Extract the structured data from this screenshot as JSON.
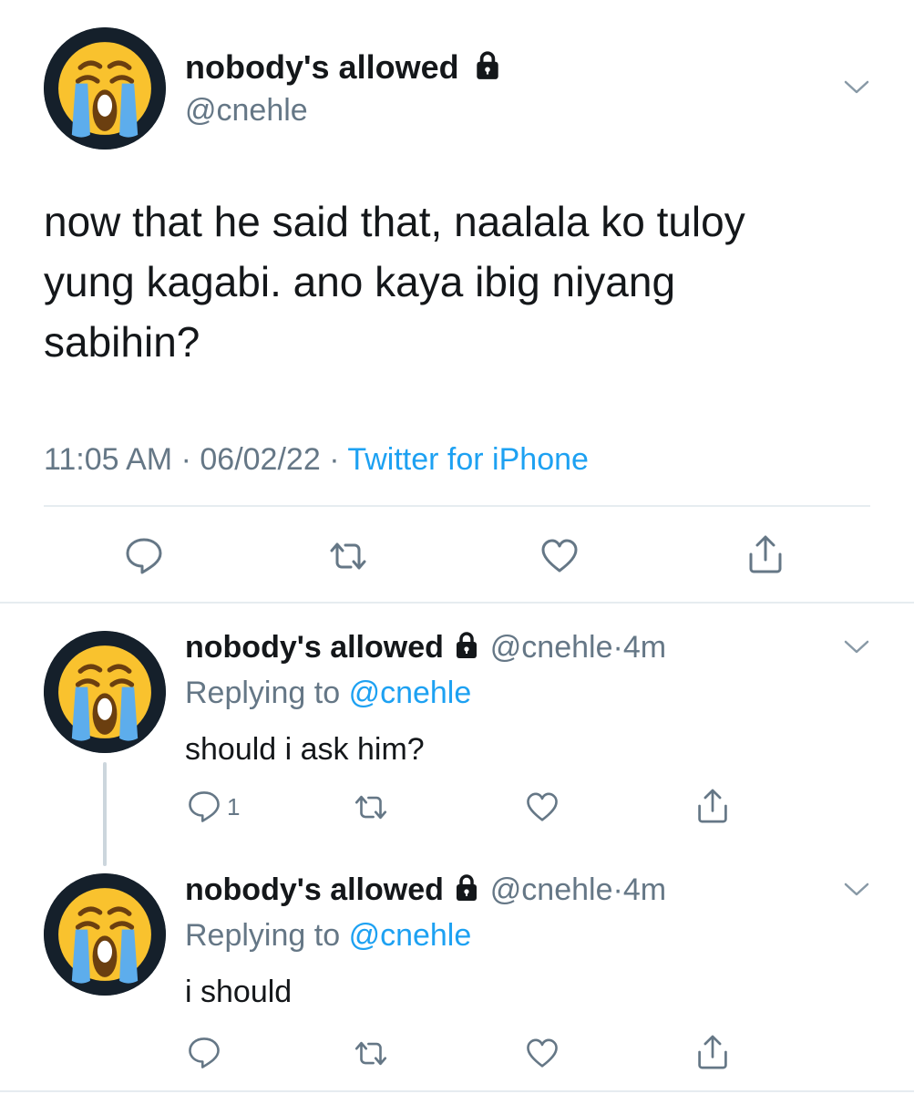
{
  "main_tweet": {
    "display_name": "nobody's allowed",
    "handle": "@cnehle",
    "text_lines": [
      "now that he said that, naalala ko tuloy",
      "yung kagabi. ano kaya ibig niyang",
      "sabihin?"
    ],
    "time": "11:05 AM",
    "date": "06/02/22",
    "separator": "·",
    "source": "Twitter for iPhone"
  },
  "replies": [
    {
      "display_name": "nobody's allowed",
      "handle": "@cnehle",
      "age": "4m",
      "separator": "·",
      "replying_prefix": "Replying to",
      "replying_handle": "@cnehle",
      "text": "should i ask him?",
      "reply_count": "1"
    },
    {
      "display_name": "nobody's allowed",
      "handle": "@cnehle",
      "age": "4m",
      "separator": "·",
      "replying_prefix": "Replying to",
      "replying_handle": "@cnehle",
      "text": "i should",
      "reply_count": ""
    }
  ],
  "colors": {
    "text": "#14171a",
    "secondary": "#657786",
    "link": "#1da1f2",
    "divider": "#e6ecf0",
    "avatar_bg": "#15202b",
    "emoji_face": "#f9c22e",
    "emoji_tears": "#5dadec"
  },
  "icons": {
    "avatar": "loudly-crying-face-emoji",
    "lock": "lock-icon",
    "menu": "chevron-down-icon",
    "reply": "reply-icon",
    "retweet": "retweet-icon",
    "like": "heart-icon",
    "share": "share-icon"
  }
}
